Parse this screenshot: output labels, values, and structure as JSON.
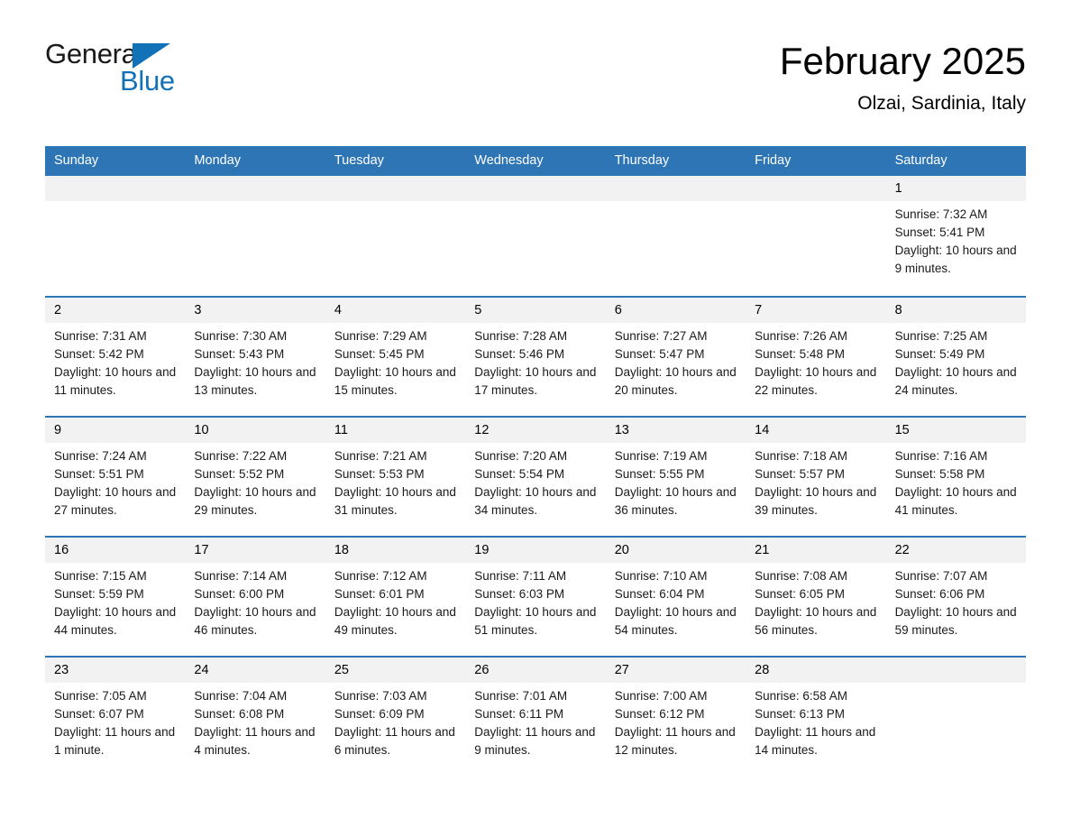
{
  "brand": {
    "name_part1": "General",
    "name_part2": "Blue",
    "accent_color": "#1272b8"
  },
  "header": {
    "month_title": "February 2025",
    "location": "Olzai, Sardinia, Italy",
    "header_bg_color": "#2e75b6",
    "day_band_color": "#f2f2f2"
  },
  "weekdays": [
    "Sunday",
    "Monday",
    "Tuesday",
    "Wednesday",
    "Thursday",
    "Friday",
    "Saturday"
  ],
  "weeks": [
    [
      {
        "day": "",
        "empty": true
      },
      {
        "day": "",
        "empty": true
      },
      {
        "day": "",
        "empty": true
      },
      {
        "day": "",
        "empty": true
      },
      {
        "day": "",
        "empty": true
      },
      {
        "day": "",
        "empty": true
      },
      {
        "day": "1",
        "sunrise": "Sunrise: 7:32 AM",
        "sunset": "Sunset: 5:41 PM",
        "daylight": "Daylight: 10 hours and 9 minutes."
      }
    ],
    [
      {
        "day": "2",
        "sunrise": "Sunrise: 7:31 AM",
        "sunset": "Sunset: 5:42 PM",
        "daylight": "Daylight: 10 hours and 11 minutes."
      },
      {
        "day": "3",
        "sunrise": "Sunrise: 7:30 AM",
        "sunset": "Sunset: 5:43 PM",
        "daylight": "Daylight: 10 hours and 13 minutes."
      },
      {
        "day": "4",
        "sunrise": "Sunrise: 7:29 AM",
        "sunset": "Sunset: 5:45 PM",
        "daylight": "Daylight: 10 hours and 15 minutes."
      },
      {
        "day": "5",
        "sunrise": "Sunrise: 7:28 AM",
        "sunset": "Sunset: 5:46 PM",
        "daylight": "Daylight: 10 hours and 17 minutes."
      },
      {
        "day": "6",
        "sunrise": "Sunrise: 7:27 AM",
        "sunset": "Sunset: 5:47 PM",
        "daylight": "Daylight: 10 hours and 20 minutes."
      },
      {
        "day": "7",
        "sunrise": "Sunrise: 7:26 AM",
        "sunset": "Sunset: 5:48 PM",
        "daylight": "Daylight: 10 hours and 22 minutes."
      },
      {
        "day": "8",
        "sunrise": "Sunrise: 7:25 AM",
        "sunset": "Sunset: 5:49 PM",
        "daylight": "Daylight: 10 hours and 24 minutes."
      }
    ],
    [
      {
        "day": "9",
        "sunrise": "Sunrise: 7:24 AM",
        "sunset": "Sunset: 5:51 PM",
        "daylight": "Daylight: 10 hours and 27 minutes."
      },
      {
        "day": "10",
        "sunrise": "Sunrise: 7:22 AM",
        "sunset": "Sunset: 5:52 PM",
        "daylight": "Daylight: 10 hours and 29 minutes."
      },
      {
        "day": "11",
        "sunrise": "Sunrise: 7:21 AM",
        "sunset": "Sunset: 5:53 PM",
        "daylight": "Daylight: 10 hours and 31 minutes."
      },
      {
        "day": "12",
        "sunrise": "Sunrise: 7:20 AM",
        "sunset": "Sunset: 5:54 PM",
        "daylight": "Daylight: 10 hours and 34 minutes."
      },
      {
        "day": "13",
        "sunrise": "Sunrise: 7:19 AM",
        "sunset": "Sunset: 5:55 PM",
        "daylight": "Daylight: 10 hours and 36 minutes."
      },
      {
        "day": "14",
        "sunrise": "Sunrise: 7:18 AM",
        "sunset": "Sunset: 5:57 PM",
        "daylight": "Daylight: 10 hours and 39 minutes."
      },
      {
        "day": "15",
        "sunrise": "Sunrise: 7:16 AM",
        "sunset": "Sunset: 5:58 PM",
        "daylight": "Daylight: 10 hours and 41 minutes."
      }
    ],
    [
      {
        "day": "16",
        "sunrise": "Sunrise: 7:15 AM",
        "sunset": "Sunset: 5:59 PM",
        "daylight": "Daylight: 10 hours and 44 minutes."
      },
      {
        "day": "17",
        "sunrise": "Sunrise: 7:14 AM",
        "sunset": "Sunset: 6:00 PM",
        "daylight": "Daylight: 10 hours and 46 minutes."
      },
      {
        "day": "18",
        "sunrise": "Sunrise: 7:12 AM",
        "sunset": "Sunset: 6:01 PM",
        "daylight": "Daylight: 10 hours and 49 minutes."
      },
      {
        "day": "19",
        "sunrise": "Sunrise: 7:11 AM",
        "sunset": "Sunset: 6:03 PM",
        "daylight": "Daylight: 10 hours and 51 minutes."
      },
      {
        "day": "20",
        "sunrise": "Sunrise: 7:10 AM",
        "sunset": "Sunset: 6:04 PM",
        "daylight": "Daylight: 10 hours and 54 minutes."
      },
      {
        "day": "21",
        "sunrise": "Sunrise: 7:08 AM",
        "sunset": "Sunset: 6:05 PM",
        "daylight": "Daylight: 10 hours and 56 minutes."
      },
      {
        "day": "22",
        "sunrise": "Sunrise: 7:07 AM",
        "sunset": "Sunset: 6:06 PM",
        "daylight": "Daylight: 10 hours and 59 minutes."
      }
    ],
    [
      {
        "day": "23",
        "sunrise": "Sunrise: 7:05 AM",
        "sunset": "Sunset: 6:07 PM",
        "daylight": "Daylight: 11 hours and 1 minute."
      },
      {
        "day": "24",
        "sunrise": "Sunrise: 7:04 AM",
        "sunset": "Sunset: 6:08 PM",
        "daylight": "Daylight: 11 hours and 4 minutes."
      },
      {
        "day": "25",
        "sunrise": "Sunrise: 7:03 AM",
        "sunset": "Sunset: 6:09 PM",
        "daylight": "Daylight: 11 hours and 6 minutes."
      },
      {
        "day": "26",
        "sunrise": "Sunrise: 7:01 AM",
        "sunset": "Sunset: 6:11 PM",
        "daylight": "Daylight: 11 hours and 9 minutes."
      },
      {
        "day": "27",
        "sunrise": "Sunrise: 7:00 AM",
        "sunset": "Sunset: 6:12 PM",
        "daylight": "Daylight: 11 hours and 12 minutes."
      },
      {
        "day": "28",
        "sunrise": "Sunrise: 6:58 AM",
        "sunset": "Sunset: 6:13 PM",
        "daylight": "Daylight: 11 hours and 14 minutes."
      },
      {
        "day": "",
        "empty": true
      }
    ]
  ]
}
